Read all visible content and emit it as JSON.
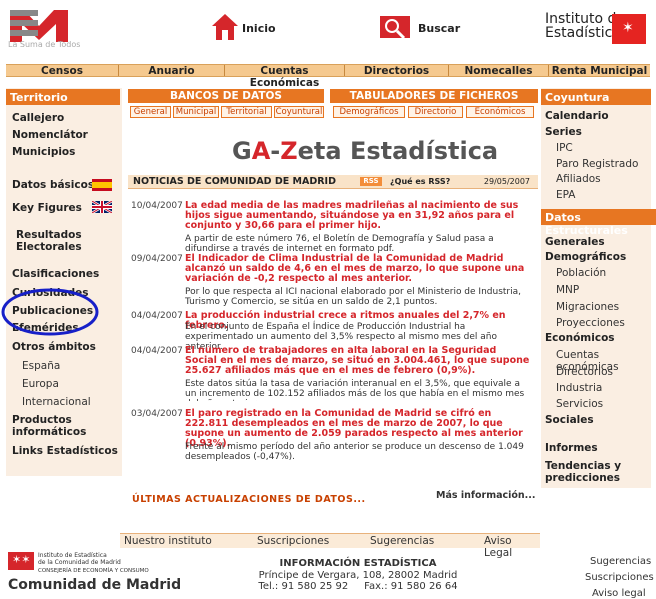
{
  "header": {
    "logo_caption": "La Suma de Todos",
    "home_label": "Inicio",
    "search_label": "Buscar",
    "institute_line1": "Instituto de",
    "institute_line2": "Estadística"
  },
  "nav": [
    "Censos",
    "Anuario",
    "Cuentas Económicas",
    "Directorios",
    "Nomecalles",
    "Renta Municipal"
  ],
  "left": {
    "section": "Territorio",
    "items": [
      "Callejero",
      "Nomenclátor",
      "Municipios"
    ],
    "datos_basicos": "Datos básicos",
    "key_figures": "Key Figures",
    "resultados": "Resultados",
    "electorales": "Electorales",
    "clasificaciones": "Clasificaciones",
    "curiosidades": "Curiosidades",
    "publicaciones": "Publicaciones",
    "efemerides": "Efemérides",
    "otros": "Otros ámbitos",
    "otros_sub": [
      "España",
      "Europa",
      "Internacional"
    ],
    "productos": "Productos",
    "informaticos": "informáticos",
    "links": "Links Estadísticos"
  },
  "banks": {
    "bancos_title": "BANCOS DE DATOS",
    "bancos_tabs": [
      "General",
      "Municipal",
      "Territorial",
      "Coyuntural"
    ],
    "tab_title": "TABULADORES DE FICHEROS",
    "tab_tabs": [
      "Demográficos",
      "Directorio",
      "Económicos"
    ]
  },
  "title": {
    "pre": "GA-",
    "red": "Z",
    "post": "eta Estadística",
    "red_a": "A"
  },
  "newsbar": {
    "title": "NOTICIAS DE COMUNIDAD DE MADRID",
    "rss": "RSS",
    "what": "¿Qué es RSS?",
    "date": "29/05/2007"
  },
  "news": [
    {
      "date": "10/04/2007",
      "headline": "La edad media de las madres madrileñas al nacimiento de sus hijos sigue aumentando, situándose ya en 31,92 años para el conjunto y 30,66 para el primer hijo.",
      "body": "A partir de este número 76, el Boletín de Demografía y Salud pasa a difundirse a través de internet en formato pdf."
    },
    {
      "date": "09/04/2007",
      "headline": "El Indicador de Clima Industrial de la Comunidad de Madrid alcanzó un saldo de 4,6 en el mes de marzo, lo que supone una variación de -0,2 respecto al mes anterior.",
      "body": "Por lo que respecta al ICI nacional elaborado por el Ministerio de Industria, Turismo y Comercio, se sitúa en un saldo de 2,1 puntos."
    },
    {
      "date": "04/04/2007",
      "headline": "La producción industrial crece a ritmos anuales del 2,7% en febrero.",
      "body": "En el conjunto de España el Índice de Producción Industrial ha experimentado un aumento del 3,5% respecto al mismo mes del año anterior."
    },
    {
      "date": "04/04/2007",
      "headline": "El número de trabajadores en alta laboral en la Seguridad Social en el mes de marzo, se situó en 3.004.461, lo que supone 25.627 afiliados más que en el mes de febrero (0,9%).",
      "body": "Este datos sitúa la tasa de variación interanual en el 3,5%, que equivale a un incremento de 102.152 afiliados más de los que había en el mismo mes del año anterior."
    },
    {
      "date": "03/04/2007",
      "headline": "El paro registrado en la Comunidad de Madrid se cifró en 222.811 desempleados en el mes de marzo de 2007, lo que supone un aumento de 2.059 parados respecto al mes anterior (0.93%).",
      "body": "Frente al mismo período del año anterior se produce un descenso de 1.049 desempleados (-0,47%)."
    }
  ],
  "ultimas": "ÚLTIMAS ACTUALIZACIONES DE DATOS...",
  "mas_info": "Más información...",
  "right": {
    "coyuntura": "Coyuntura",
    "calendario": "Calendario",
    "series": "Series",
    "series_sub": [
      "IPC",
      "Paro Registrado",
      "Afiliados",
      "EPA"
    ],
    "estructurales": "Datos Estructurales",
    "generales": "Generales",
    "demograficos": "Demográficos",
    "demo_sub": [
      "Población",
      "MNP",
      "Migraciones",
      "Proyecciones"
    ],
    "economicos": "Económicos",
    "eco_sub": [
      "Cuentas económicas",
      "Directorios",
      "Industria",
      "Servicios"
    ],
    "sociales": "Sociales",
    "informes": "Informes",
    "tendencias": "Tendencias y",
    "predicciones": "predicciones"
  },
  "footer": {
    "links": [
      "Nuestro instituto",
      "Suscripciones",
      "Sugerencias",
      "Aviso Legal"
    ],
    "logo_line1": "Instituto de Estadística",
    "logo_line2": "de la Comunidad de Madrid",
    "logo_line3": "CONSEJERÍA DE ECONOMÍA Y CONSUMO",
    "comunidad": "Comunidad de Madrid",
    "info_title": "INFORMACIÓN ESTADÍSTICA",
    "address": "Príncipe de Vergara, 108, 28002 Madrid",
    "phone": "Tel.: 91 580 25 92     Fax.: 91 580 26 64",
    "right_links": [
      "Sugerencias",
      "Suscripciones",
      "Aviso legal"
    ]
  },
  "colors": {
    "orange": "#e77622",
    "red": "#d5262b",
    "nav_bg": "#f5c98f",
    "sidebar_bg": "#faeee2"
  }
}
